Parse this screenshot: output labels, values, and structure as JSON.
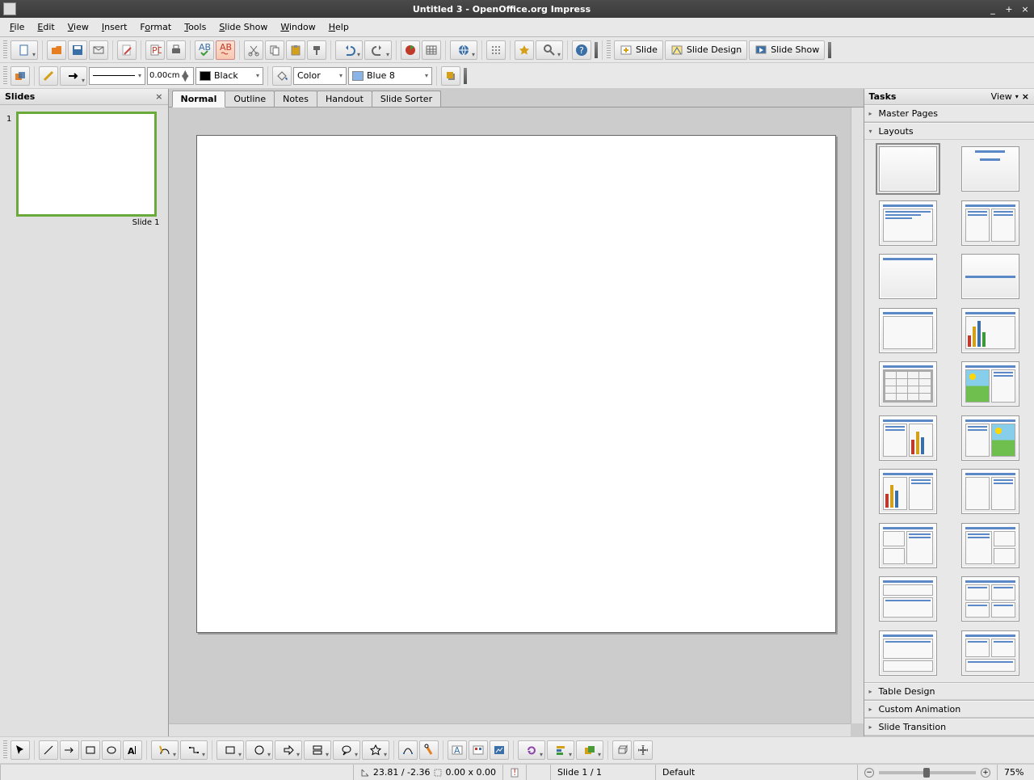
{
  "window": {
    "title": "Untitled 3 - OpenOffice.org Impress"
  },
  "menus": [
    "File",
    "Edit",
    "View",
    "Insert",
    "Format",
    "Tools",
    "Slide Show",
    "Window",
    "Help"
  ],
  "toolbar2": {
    "line_width": "0.00cm",
    "line_color_label": "Black",
    "fill_type": "Color",
    "fill_color": "Blue 8"
  },
  "toolbar1_right": {
    "slide": "Slide",
    "slide_design": "Slide Design",
    "slide_show": "Slide Show"
  },
  "slides_panel": {
    "title": "Slides",
    "items": [
      {
        "num": "1",
        "label": "Slide 1"
      }
    ]
  },
  "view_tabs": [
    "Normal",
    "Outline",
    "Notes",
    "Handout",
    "Slide Sorter"
  ],
  "tasks_panel": {
    "title": "Tasks",
    "view": "View",
    "sections": [
      "Master Pages",
      "Layouts",
      "Table Design",
      "Custom Animation",
      "Slide Transition"
    ]
  },
  "status": {
    "coords": "23.81 / -2.36",
    "size": "0.00 x 0.00",
    "slide": "Slide 1 / 1",
    "template": "Default",
    "zoom": "75%"
  }
}
